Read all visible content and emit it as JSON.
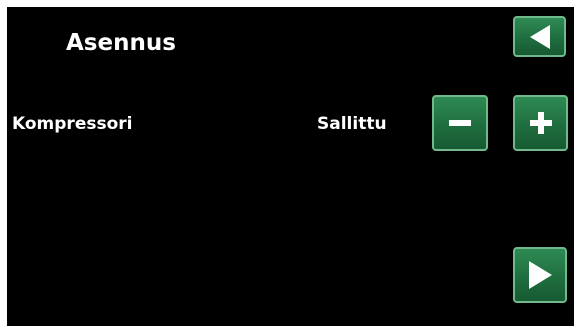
{
  "header": {
    "title": "Asennus"
  },
  "setting": {
    "label": "Kompressori",
    "value": "Sallittu"
  },
  "icons": {
    "back": "back-arrow-icon",
    "decrease": "minus-icon",
    "increase": "plus-icon",
    "next": "next-arrow-icon"
  },
  "colors": {
    "background": "#000000",
    "text": "#ffffff",
    "button": "#237644",
    "button_border": "#6fb98a"
  }
}
